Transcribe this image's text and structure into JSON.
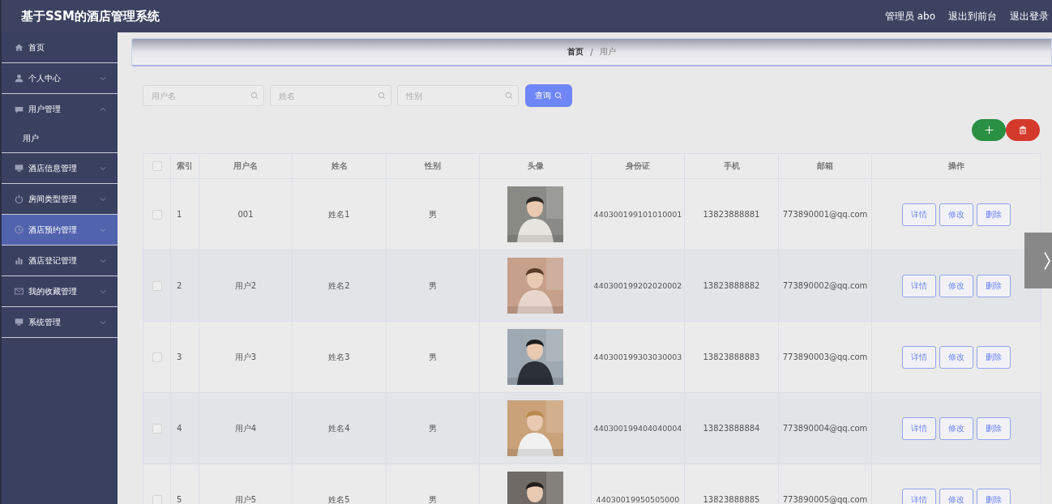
{
  "header": {
    "title": "基于SSM的酒店管理系统",
    "links": [
      "管理员 abo",
      "退出到前台",
      "退出登录"
    ]
  },
  "sidebar": {
    "items": [
      {
        "label": "首页",
        "selected": false
      },
      {
        "label": "个人中心",
        "selected": false,
        "expanded": false
      },
      {
        "label": "用户管理",
        "selected": false,
        "expanded": true,
        "children": [
          {
            "label": "用户",
            "selected": false
          }
        ]
      },
      {
        "label": "酒店信息管理",
        "selected": false,
        "expanded": false
      },
      {
        "label": "房间类型管理",
        "selected": false,
        "expanded": false
      },
      {
        "label": "酒店预约管理",
        "selected": true,
        "expanded": false
      },
      {
        "label": "酒店登记管理",
        "selected": false,
        "expanded": false
      },
      {
        "label": "我的收藏管理",
        "selected": false,
        "expanded": false
      },
      {
        "label": "系统管理",
        "selected": false,
        "expanded": false
      }
    ]
  },
  "breadcrumb": {
    "items": [
      "首页",
      "用户"
    ],
    "separator": "/"
  },
  "filters": [
    {
      "placeholder": "用户名"
    },
    {
      "placeholder": "姓名"
    },
    {
      "placeholder": "性别"
    }
  ],
  "search_button": "查询",
  "table": {
    "select_all": {
      "checked": false
    },
    "columns": [
      "索引",
      "用户名",
      "姓名",
      "性别",
      "头像",
      "身份证",
      "手机",
      "邮箱",
      "操作"
    ],
    "rows": [
      {
        "checked": false,
        "index": "1",
        "username": "001",
        "name": "姓名1",
        "gender": "男",
        "id_card": "440300199101010001",
        "phone": "13823888881",
        "email": "773890001@qq.com",
        "actions": [
          "详情",
          "修改",
          "删除"
        ]
      },
      {
        "checked": false,
        "index": "2",
        "username": "用户2",
        "name": "姓名2",
        "gender": "男",
        "id_card": "440300199202020002",
        "phone": "13823888882",
        "email": "773890002@qq.com",
        "actions": [
          "详情",
          "修改",
          "删除"
        ]
      },
      {
        "checked": false,
        "index": "3",
        "username": "用户3",
        "name": "姓名3",
        "gender": "男",
        "id_card": "440300199303030003",
        "phone": "13823888883",
        "email": "773890003@qq.com",
        "actions": [
          "详情",
          "修改",
          "删除"
        ]
      },
      {
        "checked": false,
        "index": "4",
        "username": "用户4",
        "name": "姓名4",
        "gender": "男",
        "id_card": "440300199404040004",
        "phone": "13823888884",
        "email": "773890004@qq.com",
        "actions": [
          "详情",
          "修改",
          "删除"
        ]
      },
      {
        "checked": false,
        "index": "5",
        "username": "用户5",
        "name": "姓名5",
        "gender": "男",
        "id_card": "44030019950505000",
        "phone": "13823888885",
        "email": "773890005@qq.com",
        "actions": [
          "详情",
          "修改",
          "删除"
        ]
      }
    ]
  }
}
